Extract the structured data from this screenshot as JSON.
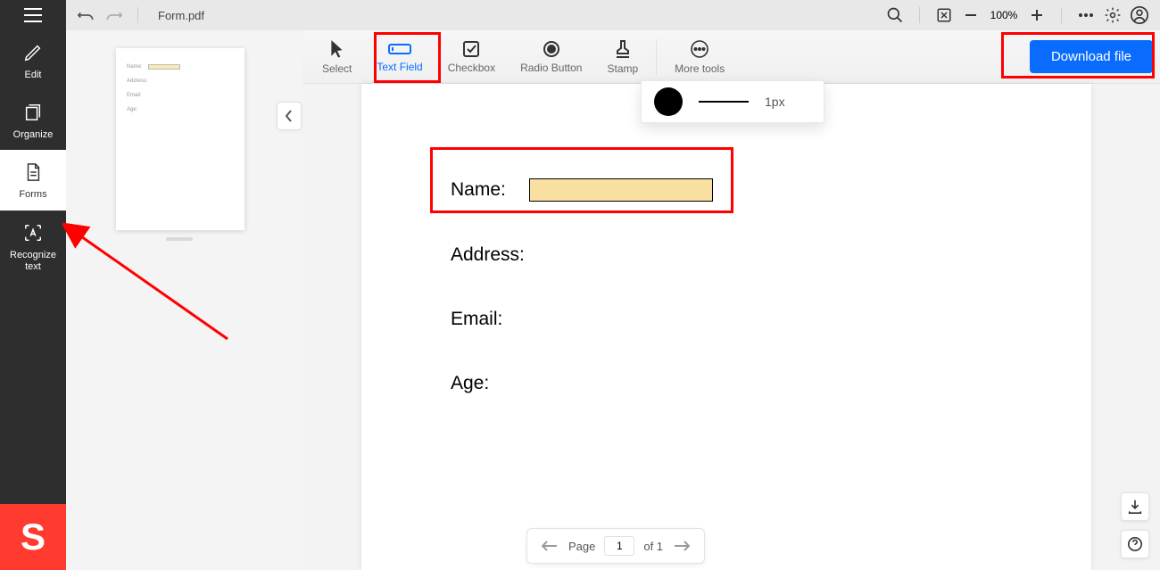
{
  "header": {
    "filename": "Form.pdf",
    "zoom_value": "100%"
  },
  "sidebar": {
    "items": [
      {
        "label": "Edit"
      },
      {
        "label": "Organize"
      },
      {
        "label": "Forms"
      },
      {
        "label": "Recognize text"
      }
    ],
    "logo": "S"
  },
  "thumb": {
    "rows": [
      "Name:",
      "Address:",
      "Email:",
      "Age:"
    ]
  },
  "toolstrip": {
    "tools": [
      {
        "label": "Select"
      },
      {
        "label": "Text Field"
      },
      {
        "label": "Checkbox"
      },
      {
        "label": "Radio Button"
      },
      {
        "label": "Stamp"
      },
      {
        "label": "More tools"
      }
    ],
    "download_label": "Download file"
  },
  "stroke_popover": {
    "color": "#000000",
    "width_label": "1px"
  },
  "page": {
    "fields": [
      {
        "label": "Name:",
        "has_field": true
      },
      {
        "label": "Address:",
        "has_field": false
      },
      {
        "label": "Email:",
        "has_field": false
      },
      {
        "label": "Age:",
        "has_field": false
      }
    ]
  },
  "pager": {
    "page_label": "Page",
    "current": "1",
    "of_label": "of 1"
  }
}
